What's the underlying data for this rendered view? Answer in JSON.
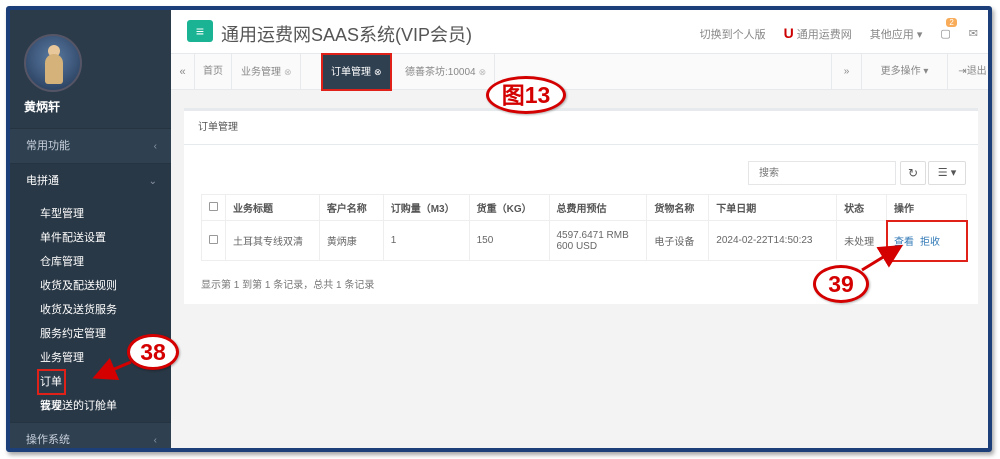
{
  "header": {
    "menu_icon": "hamburger-icon",
    "system_title": "通用运费网SAAS系统(VIP会员)",
    "switch_personal": "切换到个人版",
    "brand_link": "通用运费网",
    "other_apps": "其他应用",
    "notification_count": "2",
    "colors": {
      "accent": "#1ab394",
      "sidebar": "#2f4050",
      "annotation": "#d40000"
    }
  },
  "sidebar": {
    "username": "黄炳轩",
    "menu": [
      {
        "label": "常用功能"
      },
      {
        "label": "电拼通"
      },
      {
        "label": "操作系统"
      }
    ],
    "submenu": [
      {
        "label": "车型管理"
      },
      {
        "label": "单件配送设置"
      },
      {
        "label": "仓库管理"
      },
      {
        "label": "收货及配送规则"
      },
      {
        "label": "收货及送货服务"
      },
      {
        "label": "服务约定管理"
      },
      {
        "label": "业务管理"
      },
      {
        "label": "订单管理"
      },
      {
        "label": "我发送的订舱单"
      }
    ]
  },
  "tabs": {
    "items": [
      {
        "label": "首页"
      },
      {
        "label": "业务管理"
      },
      {
        "label": "订单管理"
      },
      {
        "label": "德善茶坊:10004"
      }
    ],
    "more_ops": "更多操作",
    "logout": "退出"
  },
  "panel": {
    "title": "订单管理",
    "search_placeholder": "搜索",
    "columns": [
      "业务标题",
      "客户名称",
      "订购量（M3）",
      "货重（KG）",
      "总费用预估",
      "货物名称",
      "下单日期",
      "状态",
      "操作"
    ],
    "rows": [
      {
        "title": "土耳其专线双清",
        "customer": "黄炳康",
        "volume": "1",
        "weight": "150",
        "cost_line1": "4597.6471 RMB",
        "cost_line2": "600 USD",
        "goods": "电子设备",
        "date": "2024-02-22T14:50:23",
        "status": "未处理",
        "op_view": "查看",
        "op_reject": "拒收"
      }
    ],
    "footnote": "显示第 1 到第 1 条记录，总共 1 条记录"
  },
  "annotations": {
    "fig": "图13",
    "n38": "38",
    "n39": "39"
  }
}
